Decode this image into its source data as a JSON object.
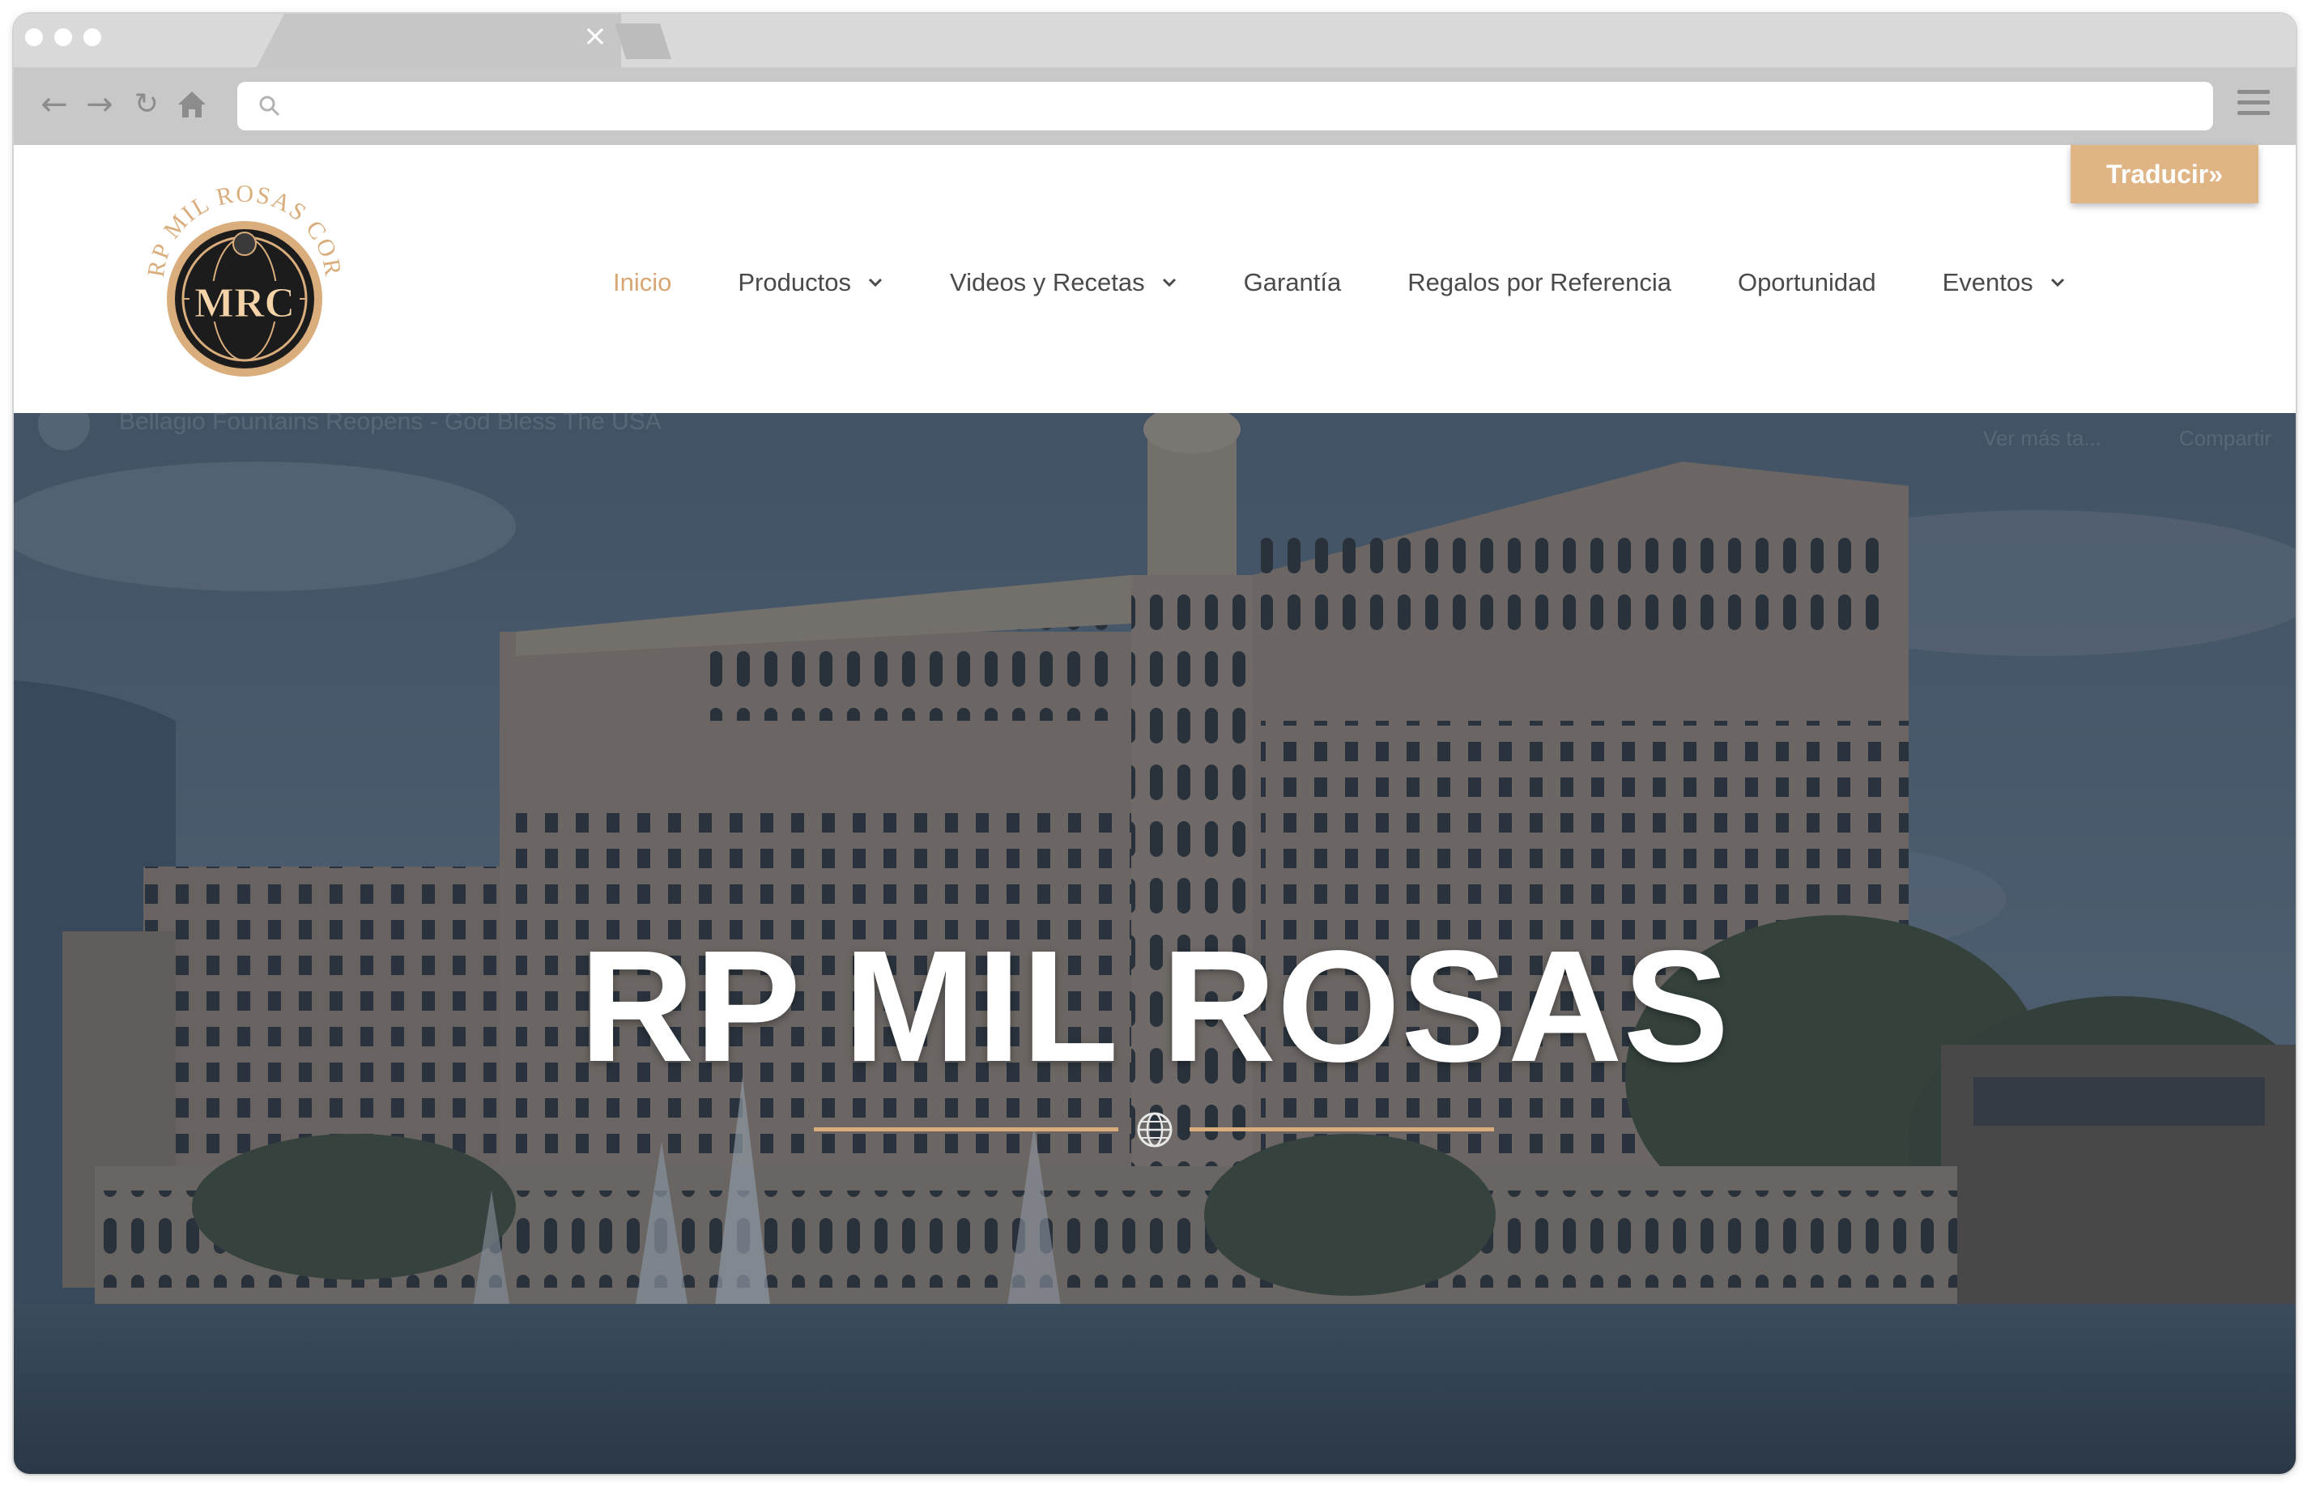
{
  "browser": {
    "tab_close_glyph": "×",
    "address": ""
  },
  "site": {
    "logo_text": "RP MIL ROSAS COR",
    "logo_monogram": "MRC",
    "nav": [
      {
        "label": "Inicio",
        "active": true
      },
      {
        "label": "Productos",
        "dropdown": true
      },
      {
        "label": "Videos y Recetas",
        "dropdown": true
      },
      {
        "label": "Garantía"
      },
      {
        "label": "Regalos por Referencia"
      },
      {
        "label": "Oportunidad"
      },
      {
        "label": "Eventos",
        "dropdown": true
      }
    ],
    "translate_label": "Traducir»",
    "accent_color": "#d9a572"
  },
  "hero": {
    "video_title": "Bellagio Fountains Reopens - God Bless The USA",
    "video_more": "Ver más ta...",
    "video_share": "Compartir",
    "title": "RP MIL ROSAS"
  }
}
